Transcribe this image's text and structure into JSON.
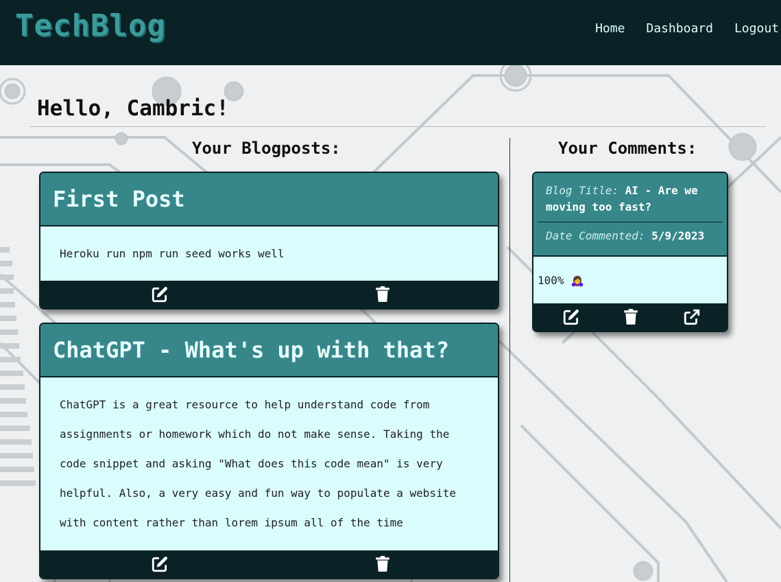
{
  "brand": {
    "logo": "TechBlog"
  },
  "nav": {
    "home": "Home",
    "dashboard": "Dashboard",
    "logout": "Logout"
  },
  "greeting": "Hello, Cambric!",
  "blogposts": {
    "heading": "Your Blogposts:",
    "items": [
      {
        "title": "First Post",
        "body": "Heroku run npm run seed works well"
      },
      {
        "title": "ChatGPT - What's up with that?",
        "body": "ChatGPT is a great resource to help understand code from assignments or homework which do not make sense. Taking the code snippet and asking \"What does this code mean\" is very helpful. Also, a very easy and fun way to populate a website with content rather than lorem ipsum all of the time"
      }
    ]
  },
  "comments": {
    "heading": "Your Comments:",
    "items": [
      {
        "blog_title_label": "Blog Title:",
        "blog_title": "AI - Are we moving too fast?",
        "date_label": "Date Commented:",
        "date": "5/9/2023",
        "text": "100% 🙇‍♀️"
      }
    ]
  },
  "icons": {
    "edit": "edit-icon",
    "delete": "trash-icon",
    "open": "external-link-icon"
  },
  "colors": {
    "navbar": "#0a2226",
    "card_header": "#37878a",
    "card_body": "#dafcfd",
    "nav_text": "#dffcfd"
  }
}
